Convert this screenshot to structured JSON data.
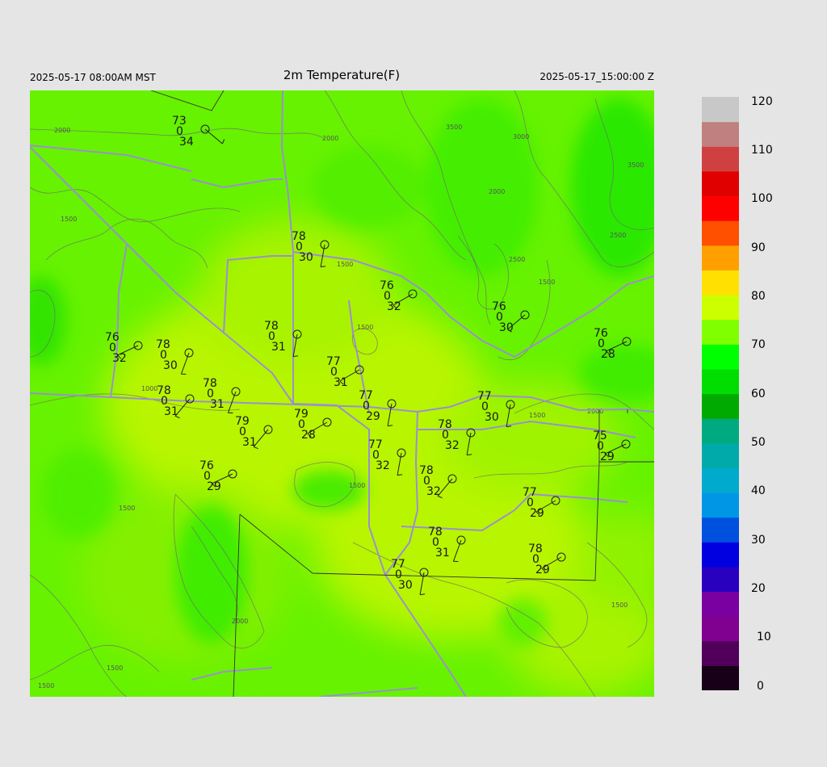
{
  "header": {
    "local_time": "2025-05-17 08:00AM MST",
    "title": "2m Temperature(F)",
    "utc_time": "2025-05-17_15:00:00 Z"
  },
  "colorbar": {
    "ticks": [
      "120",
      "110",
      "100",
      "90",
      "80",
      "70",
      "60",
      "50",
      "40",
      "30",
      "20",
      "10",
      "0"
    ],
    "range": [
      0,
      120
    ],
    "colors": [
      "#180018",
      "#50005a",
      "#800090",
      "#7a00a0",
      "#2a00c0",
      "#0000e0",
      "#0050e0",
      "#0096e6",
      "#00aacc",
      "#00aaaa",
      "#00aa80",
      "#00aa00",
      "#00dd00",
      "#00ff00",
      "#80ff00",
      "#ccff00",
      "#ffe000",
      "#ffa000",
      "#ff5000",
      "#ff0000",
      "#e00000",
      "#d04040",
      "#c08080",
      "#c8c8c8"
    ]
  },
  "map": {
    "contour_labels": [
      "2000",
      "1500",
      "2000",
      "3500",
      "3000",
      "2000",
      "3500",
      "2500",
      "2500",
      "2000",
      "1500",
      "1500",
      "1500",
      "1000",
      "1500",
      "2000",
      "1500",
      "1500",
      "1500",
      "1500",
      "1500"
    ],
    "stations": [
      {
        "t": "73",
        "d": "34",
        "z": "0"
      },
      {
        "t": "78",
        "d": "30",
        "z": "0"
      },
      {
        "t": "76",
        "d": "32",
        "z": "0"
      },
      {
        "t": "76",
        "d": "30",
        "z": "0"
      },
      {
        "t": "78",
        "d": "31",
        "z": "0"
      },
      {
        "t": "76",
        "d": "32",
        "z": "0"
      },
      {
        "t": "78",
        "d": "30",
        "z": "0"
      },
      {
        "t": "76",
        "d": "28",
        "z": "0"
      },
      {
        "t": "77",
        "d": "31",
        "z": "0"
      },
      {
        "t": "78",
        "d": "31",
        "z": "0"
      },
      {
        "t": "78",
        "d": "31",
        "z": "0"
      },
      {
        "t": "77",
        "d": "29",
        "z": "0"
      },
      {
        "t": "77",
        "d": "30",
        "z": "0"
      },
      {
        "t": "79",
        "d": "31",
        "z": "0"
      },
      {
        "t": "79",
        "d": "28",
        "z": "0"
      },
      {
        "t": "78",
        "d": "32",
        "z": "0"
      },
      {
        "t": "75",
        "d": "29",
        "z": "0"
      },
      {
        "t": "77",
        "d": "32",
        "z": "0"
      },
      {
        "t": "76",
        "d": "29",
        "z": "0"
      },
      {
        "t": "78",
        "d": "32",
        "z": "0"
      },
      {
        "t": "77",
        "d": "29",
        "z": "0"
      },
      {
        "t": "78",
        "d": "31",
        "z": "0"
      },
      {
        "t": "78",
        "d": "29",
        "z": "0"
      },
      {
        "t": "77",
        "d": "30",
        "z": "0"
      }
    ]
  }
}
